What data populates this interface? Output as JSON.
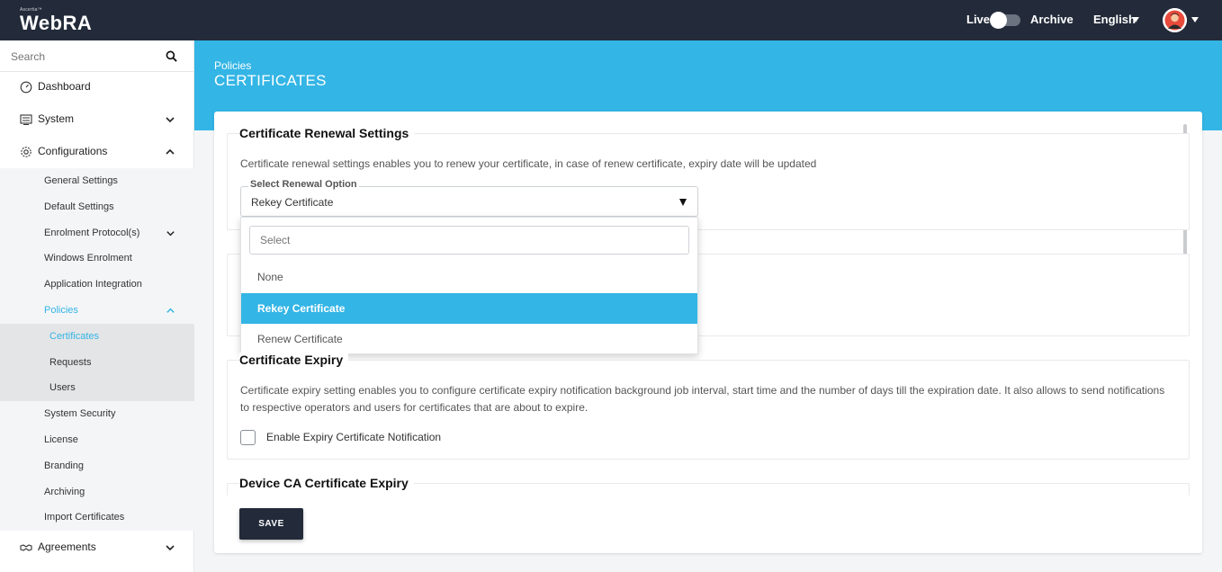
{
  "header": {
    "brand_small": "Ascertia™",
    "brand_name": "WebRA",
    "live_label": "Live",
    "archive_label": "Archive",
    "language": "English",
    "colors": {
      "topbar": "#232b3a",
      "accent": "#33b5e5"
    }
  },
  "sidebar": {
    "search_placeholder": "Search",
    "items": [
      {
        "label": "Dashboard",
        "icon": "dashboard-icon"
      },
      {
        "label": "System",
        "icon": "system-icon"
      },
      {
        "label": "Configurations",
        "icon": "gear-icon"
      },
      {
        "label": "Agreements",
        "icon": "handshake-icon"
      }
    ],
    "config_sub": [
      "General Settings",
      "Default Settings",
      "Enrolment Protocol(s)",
      "Windows Enrolment",
      "Application Integration",
      "Policies",
      "System Security",
      "License",
      "Branding",
      "Archiving",
      "Import Certificates"
    ],
    "policies_sub": [
      "Certificates",
      "Requests",
      "Users"
    ]
  },
  "page": {
    "breadcrumb": "Policies",
    "title": "CERTIFICATES"
  },
  "renewal": {
    "title": "Certificate Renewal Settings",
    "description": "Certificate renewal settings enables you to renew your certificate, in case of renew certificate, expiry date will be updated",
    "select_label": "Select Renewal Option",
    "select_value": "Rekey Certificate",
    "dropdown_search_placeholder": "Select",
    "options": [
      "None",
      "Rekey Certificate",
      "Renew Certificate"
    ]
  },
  "expiry": {
    "title": "Certificate Expiry",
    "description": "Certificate expiry setting enables you to configure certificate expiry notification background job interval, start time and the number of days till the expiration date. It also allows to send notifications to respective operators and users for certificates that are about to expire.",
    "checkbox_label": "Enable Expiry Certificate Notification"
  },
  "device_ca": {
    "title": "Device CA Certificate Expiry"
  },
  "actions": {
    "save_label": "SAVE"
  }
}
